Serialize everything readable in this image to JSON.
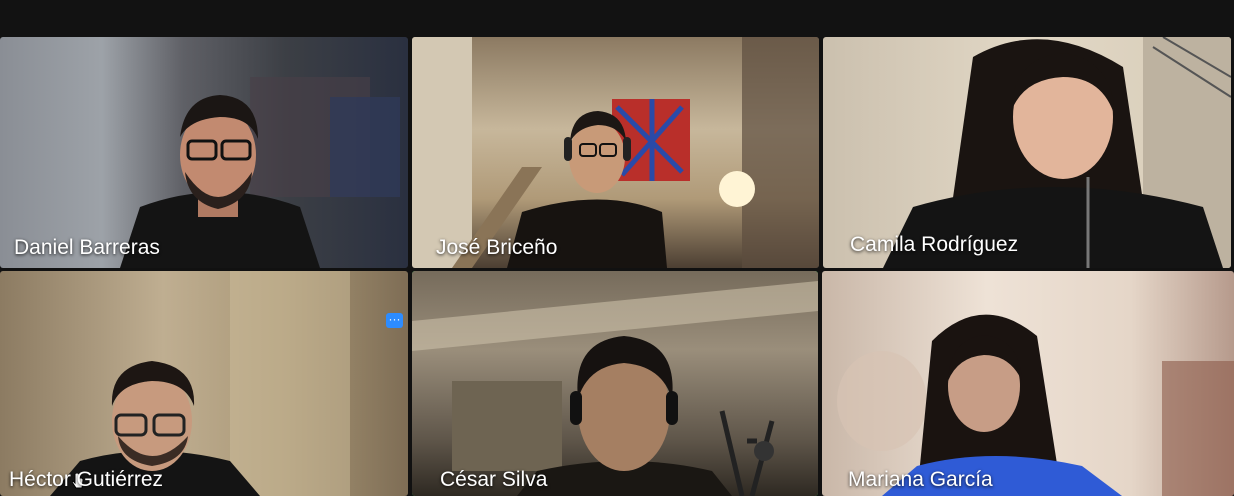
{
  "meeting": {
    "participants": [
      {
        "name": "Daniel Barreras"
      },
      {
        "name": "José Briceño"
      },
      {
        "name": "Camila Rodríguez"
      },
      {
        "name": "Héctor Gutiérrez"
      },
      {
        "name": "César Silva"
      },
      {
        "name": "Mariana García"
      }
    ],
    "more_options_icon": "ellipsis-icon",
    "more_options_glyph": "···",
    "active_speaker_color": "#23d959",
    "accent_color": "#2d8cff"
  }
}
